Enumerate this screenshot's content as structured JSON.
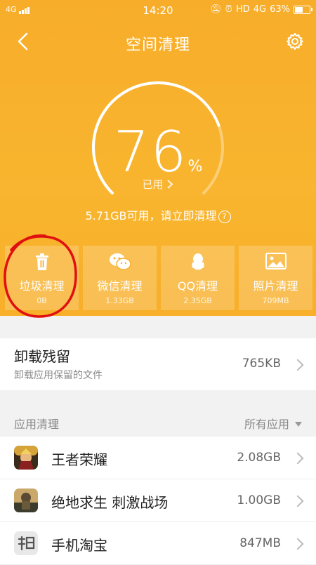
{
  "status": {
    "network": "4G",
    "time": "14:20",
    "hd": "HD",
    "net2": "4G",
    "battery": "63%",
    "battery_level": 0.63
  },
  "header": {
    "title": "空间清理",
    "back_icon": "chevron-left-icon",
    "settings_icon": "gear-icon"
  },
  "storage": {
    "used_value": "76",
    "used_unit": "%",
    "used_fraction": 0.76,
    "used_label": "已用",
    "available_text": "5.71GB可用，请立即清理",
    "help_glyph": "?"
  },
  "cards": [
    {
      "label": "垃圾清理",
      "size": "0B",
      "icon": "trash-icon"
    },
    {
      "label": "微信清理",
      "size": "1.33GB",
      "icon": "wechat-icon"
    },
    {
      "label": "QQ清理",
      "size": "2.35GB",
      "icon": "qq-icon"
    },
    {
      "label": "照片清理",
      "size": "709MB",
      "icon": "photo-icon"
    }
  ],
  "residual": {
    "title": "卸载残留",
    "subtitle": "卸载应用保留的文件",
    "size": "765KB"
  },
  "app_section": {
    "header": "应用清理",
    "filter": "所有应用"
  },
  "apps": [
    {
      "name": "王者荣耀",
      "size": "2.08GB",
      "icon": "honor-of-kings-icon"
    },
    {
      "name": "绝地求生 刺激战场",
      "size": "1.00GB",
      "icon": "pubg-icon"
    },
    {
      "name": "手机淘宝",
      "size": "847MB",
      "icon": "taobao-icon"
    }
  ],
  "colors": {
    "accent": "#f8af29",
    "annotation": "#e01010"
  }
}
